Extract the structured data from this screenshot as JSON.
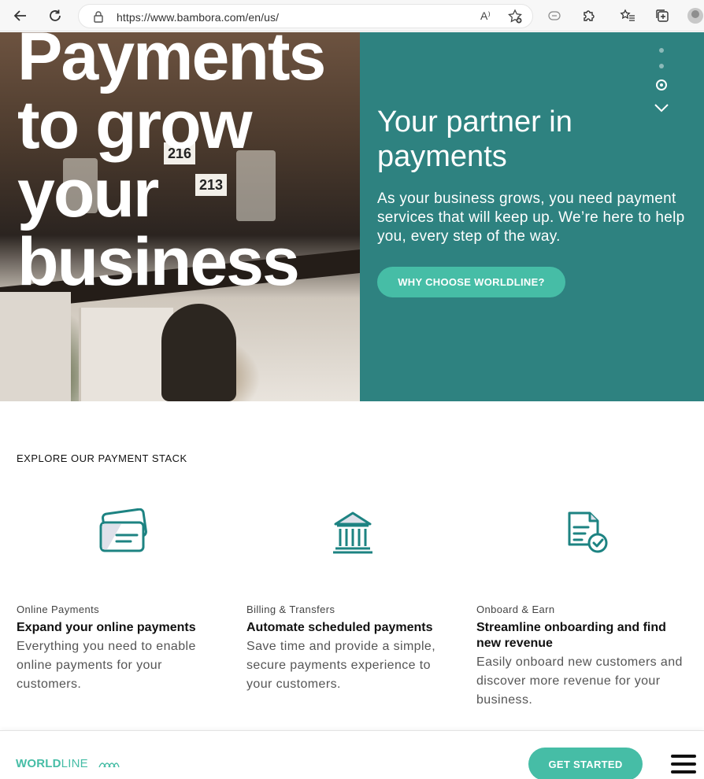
{
  "browser": {
    "url": "https://www.bambora.com/en/us/",
    "read_aloud": "A⁾"
  },
  "hero": {
    "title": "Payments to grow your business",
    "panel_title": "Your partner in payments",
    "panel_text": "As your business grows, you need payment services that will keep up. We’re here to help you, every step of the way.",
    "cta_label": "WHY CHOOSE WORLDLINE?",
    "slides_total": 3,
    "slide_active": 3,
    "photo_signs": [
      "216",
      "213"
    ],
    "colors": {
      "panel": "#2e8280",
      "button": "#46bda6"
    }
  },
  "explore": {
    "heading": "EXPLORE OUR PAYMENT STACK",
    "cards": [
      {
        "icon": "payment-cards-icon",
        "kicker": "Online Payments",
        "title": "Expand your online payments",
        "description": "Everything you need to enable online payments for your customers."
      },
      {
        "icon": "bank-building-icon",
        "kicker": "Billing & Transfers",
        "title": "Automate scheduled payments",
        "description": "Save time and provide a simple, secure payments experience to your customers."
      },
      {
        "icon": "document-check-icon",
        "kicker": "Onboard & Earn",
        "title": "Streamline onboarding and find new revenue",
        "description": "Easily onboard new customers and discover more revenue for your business."
      }
    ]
  },
  "footer": {
    "logo_bold": "WORLD",
    "logo_light": "LINE",
    "cta_label": "GET STARTED",
    "colors": {
      "brand": "#46bda6"
    }
  }
}
